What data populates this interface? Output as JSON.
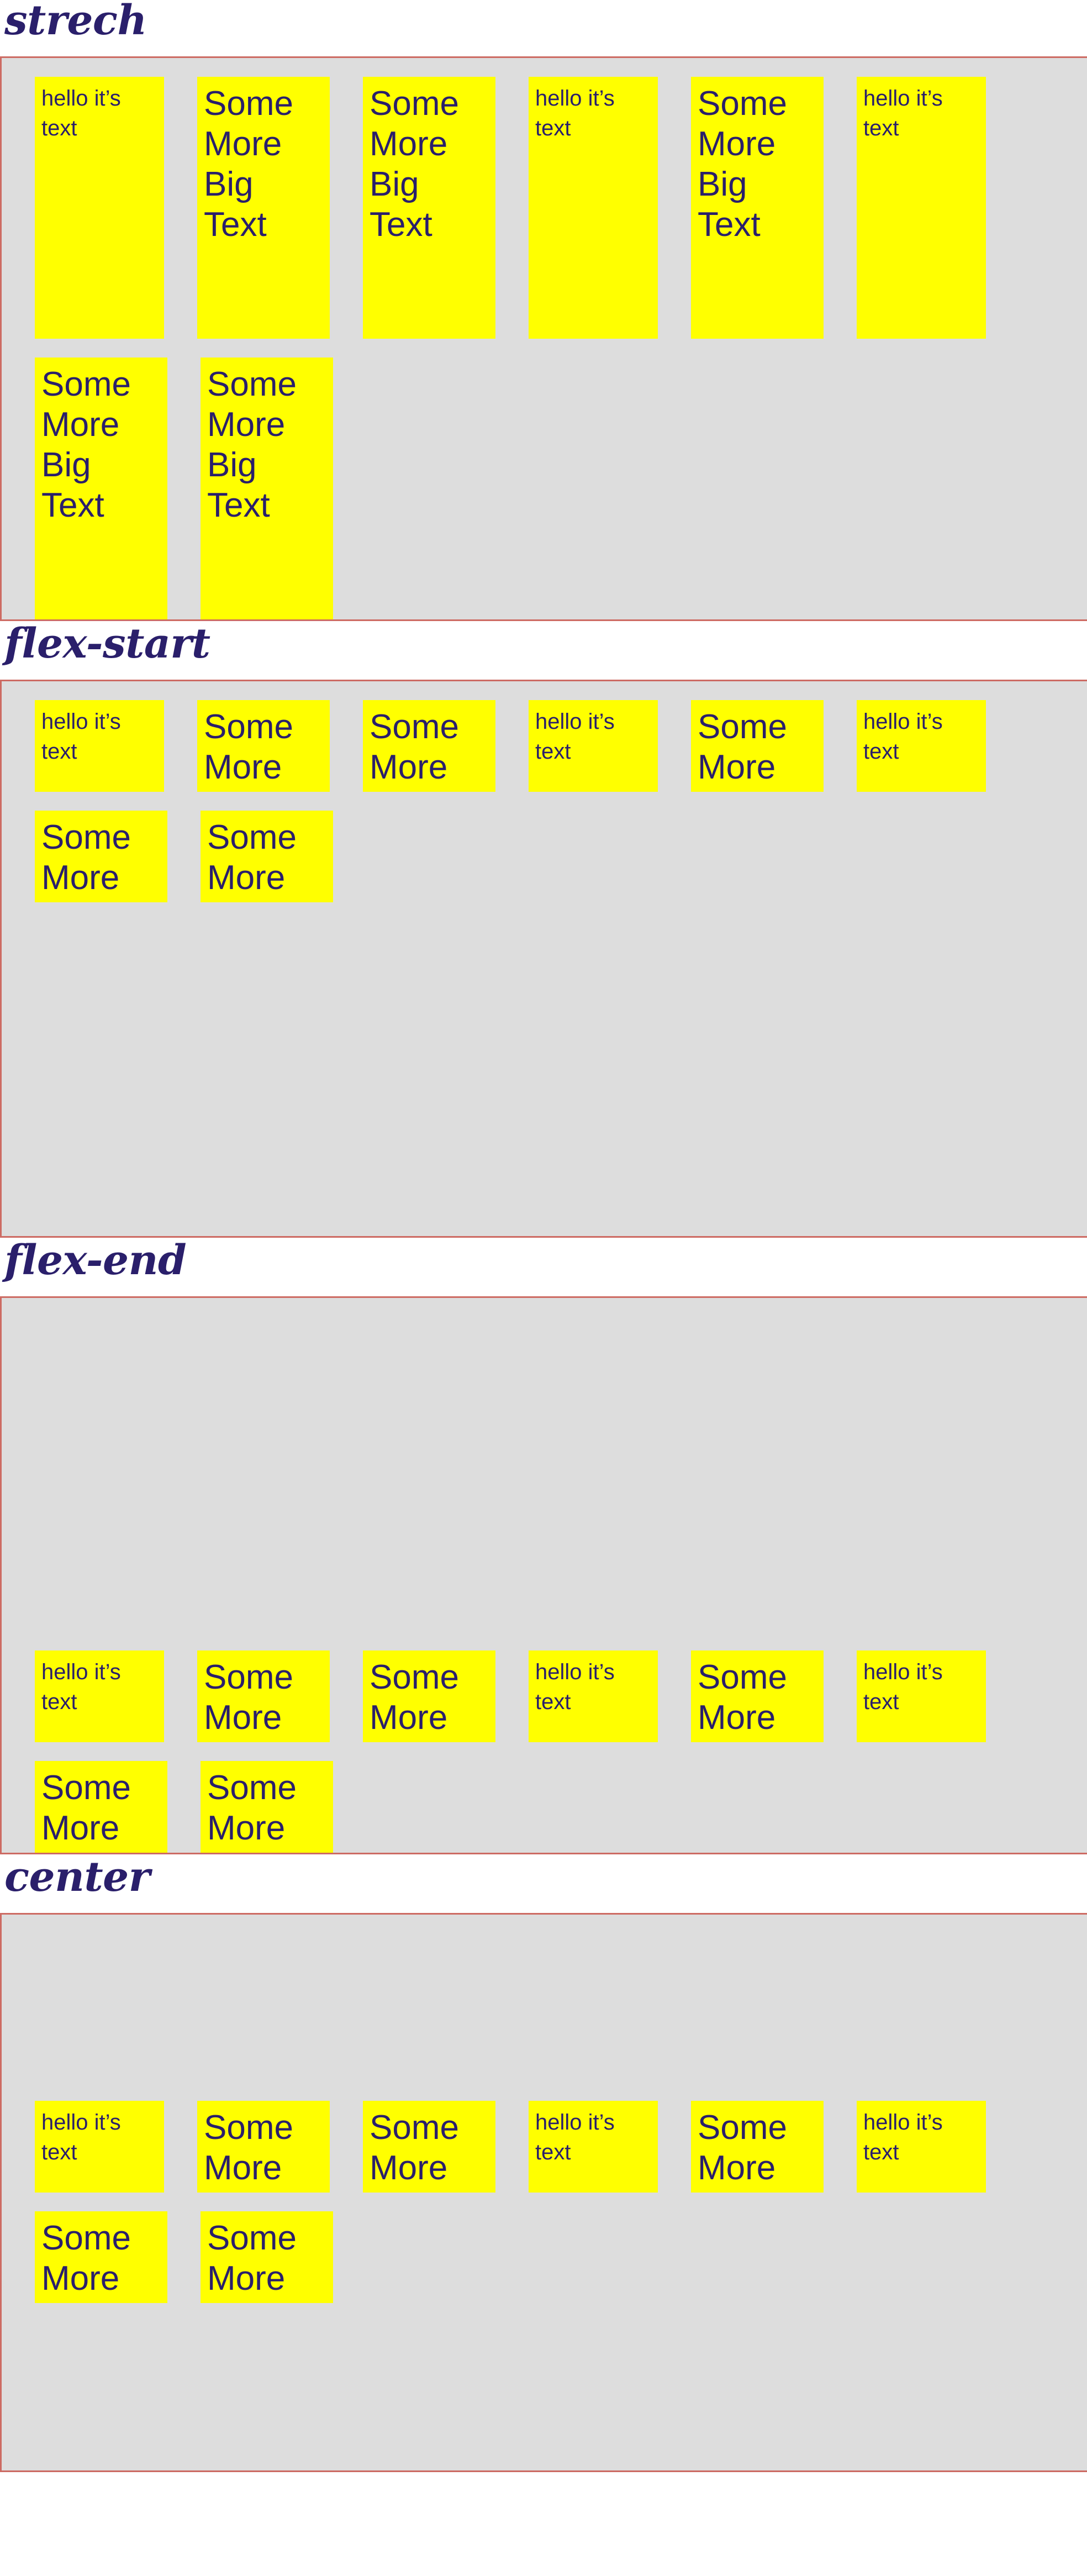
{
  "page": {
    "background_color": "#ffffff",
    "heading_color": "#2a1f6b",
    "container_background": "#dddddd",
    "container_border_color": "#cd6b63",
    "item_background": "#ffff00",
    "item_text_color": "#2a1f6b"
  },
  "item_labels": {
    "small": "hello it’s text",
    "big": "Some More Big Text"
  },
  "sections": [
    {
      "heading": "strech",
      "align_content": "stretch",
      "items": [
        {
          "size": "small",
          "text": "hello it’s text"
        },
        {
          "size": "big",
          "text": "Some More Big Text"
        },
        {
          "size": "big",
          "text": "Some More Big Text"
        },
        {
          "size": "small",
          "text": "hello it’s text"
        },
        {
          "size": "big",
          "text": "Some More Big Text"
        },
        {
          "size": "small",
          "text": "hello it’s text"
        },
        {
          "size": "big",
          "text": "Some More Big Text"
        },
        {
          "size": "big",
          "text": "Some More Big Text"
        }
      ]
    },
    {
      "heading": "flex-start",
      "align_content": "flex-start",
      "items": [
        {
          "size": "small",
          "text": "hello it’s text"
        },
        {
          "size": "big",
          "text": "Some More Big Text"
        },
        {
          "size": "big",
          "text": "Some More Big Text"
        },
        {
          "size": "small",
          "text": "hello it’s text"
        },
        {
          "size": "big",
          "text": "Some More Big Text"
        },
        {
          "size": "small",
          "text": "hello it’s text"
        },
        {
          "size": "big",
          "text": "Some More Big Text"
        },
        {
          "size": "big",
          "text": "Some More Big Text"
        }
      ]
    },
    {
      "heading": "flex-end",
      "align_content": "flex-end",
      "items": [
        {
          "size": "small",
          "text": "hello it’s text"
        },
        {
          "size": "big",
          "text": "Some More Big Text"
        },
        {
          "size": "big",
          "text": "Some More Big Text"
        },
        {
          "size": "small",
          "text": "hello it’s text"
        },
        {
          "size": "big",
          "text": "Some More Big Text"
        },
        {
          "size": "small",
          "text": "hello it’s text"
        },
        {
          "size": "big",
          "text": "Some More Big Text"
        },
        {
          "size": "big",
          "text": "Some More Big Text"
        }
      ]
    },
    {
      "heading": "center",
      "align_content": "center",
      "items": [
        {
          "size": "small",
          "text": "hello it’s text"
        },
        {
          "size": "big",
          "text": "Some More Big Text"
        },
        {
          "size": "big",
          "text": "Some More Big Text"
        },
        {
          "size": "small",
          "text": "hello it’s text"
        },
        {
          "size": "big",
          "text": "Some More Big Text"
        },
        {
          "size": "small",
          "text": "hello it’s text"
        },
        {
          "size": "big",
          "text": "Some More Big Text"
        },
        {
          "size": "big",
          "text": "Some More Big Text"
        }
      ]
    }
  ]
}
